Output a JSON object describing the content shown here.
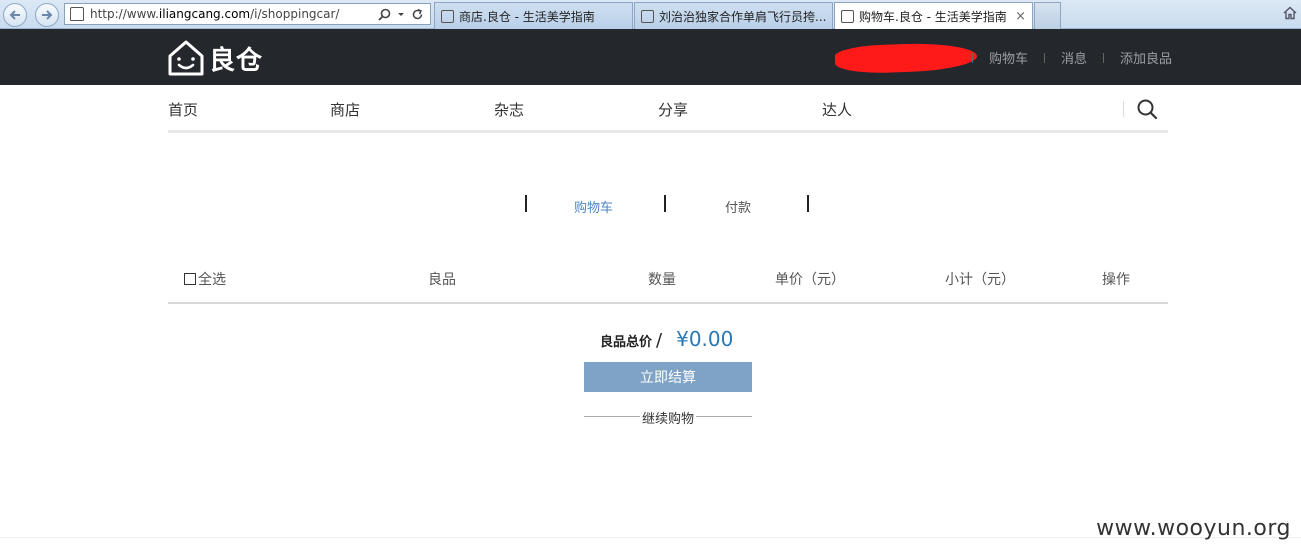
{
  "browser": {
    "url_prefix": "http://www.",
    "url_domain": "iliangcang.com",
    "url_path": "/i/shoppingcar/",
    "tabs": [
      {
        "title": "商店.良仓 - 生活美学指南"
      },
      {
        "title": "刘治治独家合作单肩飞行员挎..."
      },
      {
        "title": "购物车.良仓 - 生活美学指南",
        "active": true
      }
    ],
    "close_glyph": "×"
  },
  "header": {
    "logo_text": "良仓",
    "links": {
      "cart": "购物车",
      "messages": "消息",
      "add_item": "添加良品"
    }
  },
  "nav": {
    "items": [
      "首页",
      "商店",
      "杂志",
      "分享",
      "达人"
    ]
  },
  "steps": {
    "cart": "购物车",
    "payment": "付款"
  },
  "cart_table": {
    "select_all": "全选",
    "col_item": "良品",
    "col_qty": "数量",
    "col_price": "单价（元）",
    "col_subtotal": "小计（元）",
    "col_action": "操作"
  },
  "summary": {
    "total_label": "良品总价",
    "slash": "/",
    "total_amount": "¥0.00",
    "checkout_label": "立即结算",
    "continue_label": "继续购物"
  },
  "watermark": "www.wooyun.org",
  "colors": {
    "accent": "#2a78b5",
    "button": "#7fa3c6",
    "header_bg": "#24272c"
  }
}
